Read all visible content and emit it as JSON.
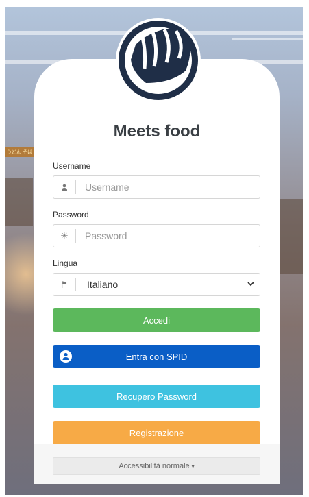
{
  "app": {
    "title": "Meets food"
  },
  "background": {
    "sign_text": "うどん そば"
  },
  "form": {
    "username": {
      "label": "Username",
      "placeholder": "Username",
      "icon": "user-icon"
    },
    "password": {
      "label": "Password",
      "placeholder": "Password",
      "icon": "asterisk-icon"
    },
    "language": {
      "label": "Lingua",
      "selected": "Italiano",
      "icon": "flag-icon"
    }
  },
  "buttons": {
    "login": "Accedi",
    "spid": "Entra con SPID",
    "recover": "Recupero Password",
    "register": "Registrazione"
  },
  "accessibility": {
    "label": "Accessibilità normale"
  },
  "colors": {
    "login": "#5cb85c",
    "spid": "#0a5ec6",
    "recover": "#3ec2e0",
    "register": "#f7aa46",
    "logo": "#1f2e47"
  }
}
